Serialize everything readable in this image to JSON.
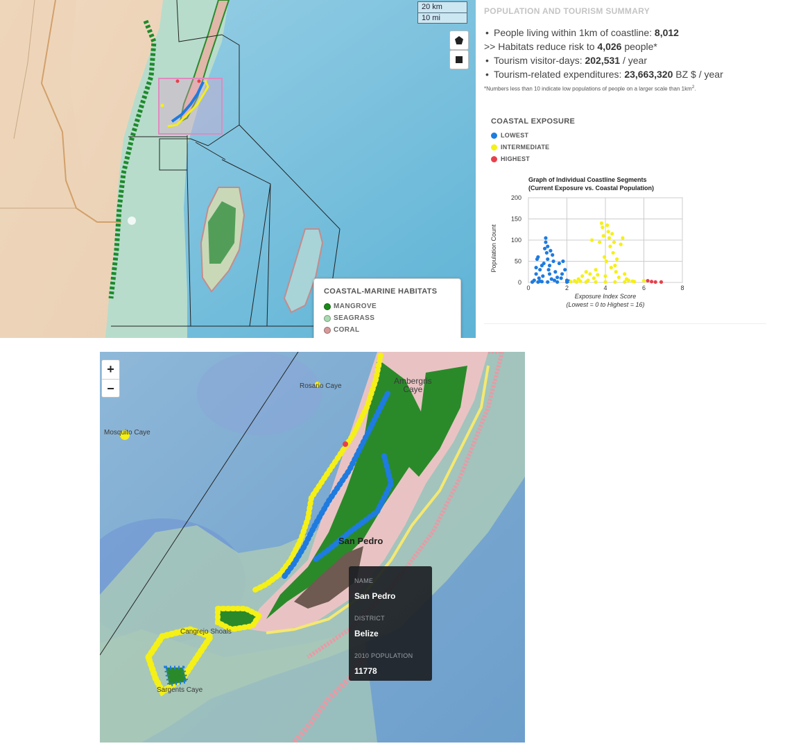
{
  "top_map": {
    "scale": {
      "km": "20 km",
      "mi": "10 mi"
    },
    "draw_tools": [
      {
        "name": "polygon",
        "icon": "pentagon-icon"
      },
      {
        "name": "rectangle",
        "icon": "square-icon"
      }
    ],
    "legend": {
      "title": "COASTAL-MARINE HABITATS",
      "items": [
        {
          "label": "MANGROVE",
          "color": "#1a8a1a"
        },
        {
          "label": "SEAGRASS",
          "color": "#a8dcb0"
        },
        {
          "label": "CORAL",
          "color": "#d79a9a"
        }
      ]
    }
  },
  "panel": {
    "title": "POPULATION AND TOURISM SUMMARY",
    "stats": {
      "people_text": "People living within 1km of coastline: ",
      "people_value": "8,012",
      "habitat_text": ">> Habitats reduce risk to ",
      "habitat_value": "4,026",
      "habitat_suffix": " people*",
      "tourism_text": "Tourism visitor-days: ",
      "tourism_value": "202,531",
      "tourism_suffix": " / year",
      "expend_text": "Tourism-related expenditures: ",
      "expend_value": "23,663,320",
      "expend_suffix": " BZ $ / year"
    },
    "footnote": "*Numbers less than 10 indicate low populations of people on a larger scale than 1km",
    "footnote_sup": "2",
    "footnote_end": ".",
    "exposure": {
      "title": "COASTAL EXPOSURE",
      "items": [
        {
          "label": "LOWEST",
          "color": "#1e7be0"
        },
        {
          "label": "INTERMEDIATE",
          "color": "#f5f016"
        },
        {
          "label": "HIGHEST",
          "color": "#e8404a"
        }
      ]
    }
  },
  "chart_data": {
    "type": "scatter",
    "title": "Graph of Individual Coastline Segments",
    "subtitle": "(Current Exposure vs. Coastal Population)",
    "xlabel": "Exposure Index Score",
    "xlabel2": "(Lowest = 0 to Highest = 16)",
    "ylabel": "Population Count",
    "xlim": [
      0,
      8
    ],
    "ylim": [
      0,
      200
    ],
    "xticks": [
      0,
      2,
      4,
      6,
      8
    ],
    "yticks": [
      0,
      50,
      100,
      150,
      200
    ],
    "grid": true,
    "series": [
      {
        "color": "#1e7be0",
        "points": [
          [
            0.3,
            5
          ],
          [
            0.4,
            20
          ],
          [
            0.4,
            35
          ],
          [
            0.45,
            55
          ],
          [
            0.5,
            60
          ],
          [
            0.55,
            10
          ],
          [
            0.6,
            3
          ],
          [
            0.7,
            2
          ],
          [
            0.75,
            15
          ],
          [
            0.8,
            45
          ],
          [
            0.85,
            80
          ],
          [
            0.9,
            105
          ],
          [
            0.9,
            95
          ],
          [
            0.95,
            70
          ],
          [
            1.0,
            85
          ],
          [
            1.0,
            55
          ],
          [
            1.05,
            30
          ],
          [
            1.1,
            40
          ],
          [
            1.1,
            20
          ],
          [
            1.2,
            8
          ],
          [
            1.25,
            65
          ],
          [
            1.3,
            50
          ],
          [
            1.4,
            25
          ],
          [
            1.5,
            12
          ],
          [
            1.6,
            45
          ],
          [
            1.7,
            10
          ],
          [
            1.8,
            50
          ],
          [
            1.9,
            30
          ],
          [
            2.0,
            5
          ],
          [
            0.2,
            1
          ],
          [
            0.5,
            1
          ],
          [
            1.0,
            1
          ],
          [
            1.5,
            1
          ],
          [
            2.0,
            1
          ],
          [
            0.6,
            30
          ],
          [
            0.7,
            40
          ],
          [
            1.15,
            75
          ],
          [
            1.35,
            5
          ],
          [
            1.75,
            20
          ],
          [
            2.1,
            3
          ]
        ]
      },
      {
        "color": "#f5f016",
        "points": [
          [
            2.2,
            2
          ],
          [
            2.4,
            4
          ],
          [
            2.6,
            8
          ],
          [
            2.7,
            3
          ],
          [
            2.8,
            15
          ],
          [
            3.0,
            25
          ],
          [
            3.1,
            5
          ],
          [
            3.2,
            20
          ],
          [
            3.3,
            100
          ],
          [
            3.4,
            10
          ],
          [
            3.5,
            30
          ],
          [
            3.6,
            18
          ],
          [
            3.7,
            95
          ],
          [
            3.8,
            140
          ],
          [
            3.85,
            130
          ],
          [
            3.9,
            110
          ],
          [
            3.95,
            60
          ],
          [
            4.0,
            15
          ],
          [
            4.05,
            50
          ],
          [
            4.1,
            135
          ],
          [
            4.15,
            120
          ],
          [
            4.2,
            105
          ],
          [
            4.25,
            85
          ],
          [
            4.3,
            35
          ],
          [
            4.35,
            115
          ],
          [
            4.4,
            70
          ],
          [
            4.45,
            95
          ],
          [
            4.5,
            40
          ],
          [
            4.55,
            25
          ],
          [
            4.6,
            55
          ],
          [
            4.7,
            12
          ],
          [
            4.8,
            90
          ],
          [
            4.9,
            105
          ],
          [
            5.0,
            20
          ],
          [
            5.1,
            8
          ],
          [
            5.2,
            5
          ],
          [
            5.4,
            3
          ],
          [
            2.5,
            1
          ],
          [
            3.0,
            1
          ],
          [
            3.5,
            1
          ],
          [
            4.0,
            1
          ],
          [
            4.5,
            1
          ],
          [
            5.0,
            1
          ],
          [
            5.5,
            2
          ],
          [
            6.0,
            4
          ]
        ]
      },
      {
        "color": "#e8404a",
        "points": [
          [
            6.2,
            4
          ],
          [
            6.4,
            2
          ],
          [
            6.6,
            1
          ],
          [
            6.9,
            1
          ]
        ]
      }
    ]
  },
  "bottom_map": {
    "zoom_in": "+",
    "zoom_out": "−",
    "labels": {
      "rosario": "Rosario Caye",
      "mosquito": "Mosquito Caye",
      "ambergris": "Ambergris\nCaye",
      "san_pedro": "San Pedro",
      "cangrejo": "Cangrejo Shoals",
      "sargent": "Sargents Caye"
    },
    "tooltip": {
      "name_key": "NAME",
      "name_val": "San Pedro",
      "district_key": "DISTRICT",
      "district_val": "Belize",
      "pop_key": "2010 POPULATION",
      "pop_val": "11778"
    }
  }
}
